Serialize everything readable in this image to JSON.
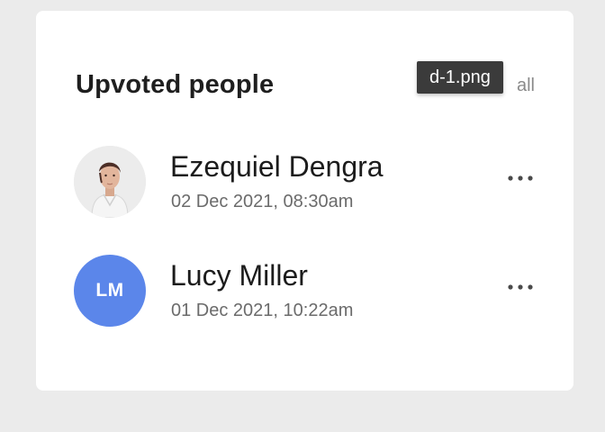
{
  "card": {
    "title": "Upvoted people",
    "see_all": "all"
  },
  "tooltip": {
    "text": "d-1.png"
  },
  "people": [
    {
      "name": "Ezequiel Dengra",
      "time": "02 Dec 2021, 08:30am",
      "avatar": "photo"
    },
    {
      "name": "Lucy Miller",
      "time": "01 Dec 2021, 10:22am",
      "avatar_initials": "LM",
      "avatar_color": "#5b86ea"
    }
  ],
  "icons": {
    "more": "more-horizontal-icon"
  }
}
